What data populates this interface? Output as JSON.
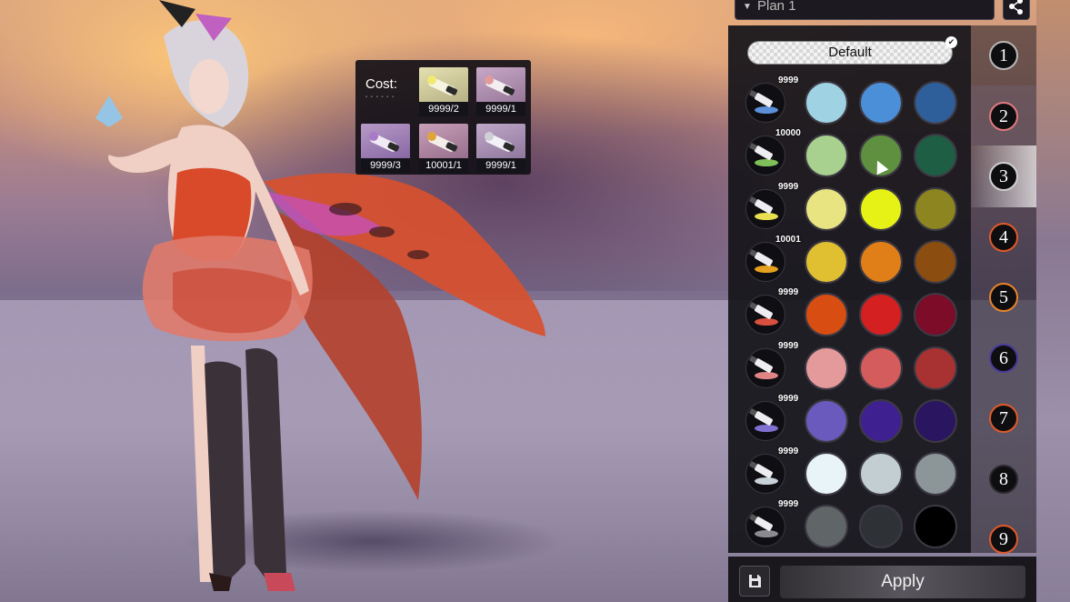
{
  "plan": {
    "selected": "Plan 1"
  },
  "cost_panel": {
    "label": "Cost:",
    "items": [
      {
        "qty": "9999/2",
        "color": "#e9e58a"
      },
      {
        "qty": "9999/1",
        "color": "#e39a9a"
      },
      {
        "qty": "9999/3",
        "color": "#a97ac7"
      },
      {
        "qty": "10001/1",
        "color": "#e0a53a"
      },
      {
        "qty": "9999/1",
        "color": "#cfcfd6"
      }
    ]
  },
  "palette": {
    "default_label": "Default",
    "rows": [
      {
        "count": "9999",
        "tube_color": "#5b8fd8",
        "swatches": [
          "#9fd3e3",
          "#4a8fd8",
          "#2f5f9a"
        ]
      },
      {
        "count": "10000",
        "tube_color": "#7fbf5a",
        "swatches": [
          "#a8d08e",
          "#5f9040",
          "#1d5e45"
        ]
      },
      {
        "count": "9999",
        "tube_color": "#e8e050",
        "swatches": [
          "#e8e482",
          "#e6f216",
          "#8c8520"
        ]
      },
      {
        "count": "10001",
        "tube_color": "#e6a020",
        "swatches": [
          "#e0c030",
          "#e07e18",
          "#8c4e10"
        ]
      },
      {
        "count": "9999",
        "tube_color": "#d85040",
        "swatches": [
          "#d84e12",
          "#d42020",
          "#7c0c28"
        ]
      },
      {
        "count": "9999",
        "tube_color": "#e08585",
        "swatches": [
          "#e49a9a",
          "#d45c5c",
          "#a83232"
        ]
      },
      {
        "count": "9999",
        "tube_color": "#8070d0",
        "swatches": [
          "#6a5abe",
          "#3f2090",
          "#2a1560"
        ]
      },
      {
        "count": "9999",
        "tube_color": "#c8d0d8",
        "swatches": [
          "#e8f4f8",
          "#c2ced2",
          "#8c9598"
        ]
      },
      {
        "count": "9999",
        "tube_color": "#8a8a90",
        "swatches": [
          "#606568",
          "#2e3236",
          "#000000"
        ]
      }
    ]
  },
  "plans": [
    {
      "num": "1",
      "ring": "#b8b8b8"
    },
    {
      "num": "2",
      "ring": "#e07a80"
    },
    {
      "num": "3",
      "ring": "#d0d0d0"
    },
    {
      "num": "4",
      "ring": "#e05a28"
    },
    {
      "num": "5",
      "ring": "#e8842a"
    },
    {
      "num": "6",
      "ring": "#4a3a9a"
    },
    {
      "num": "7",
      "ring": "#e05a28"
    },
    {
      "num": "8",
      "ring": "#2a2a2e"
    },
    {
      "num": "9",
      "ring": "#e05a28"
    }
  ],
  "apply_label": "Apply",
  "icons": [
    "share-icon",
    "save-icon",
    "dropdown-arrow-icon",
    "check-icon",
    "cursor-icon",
    "paint-tube-icon"
  ]
}
